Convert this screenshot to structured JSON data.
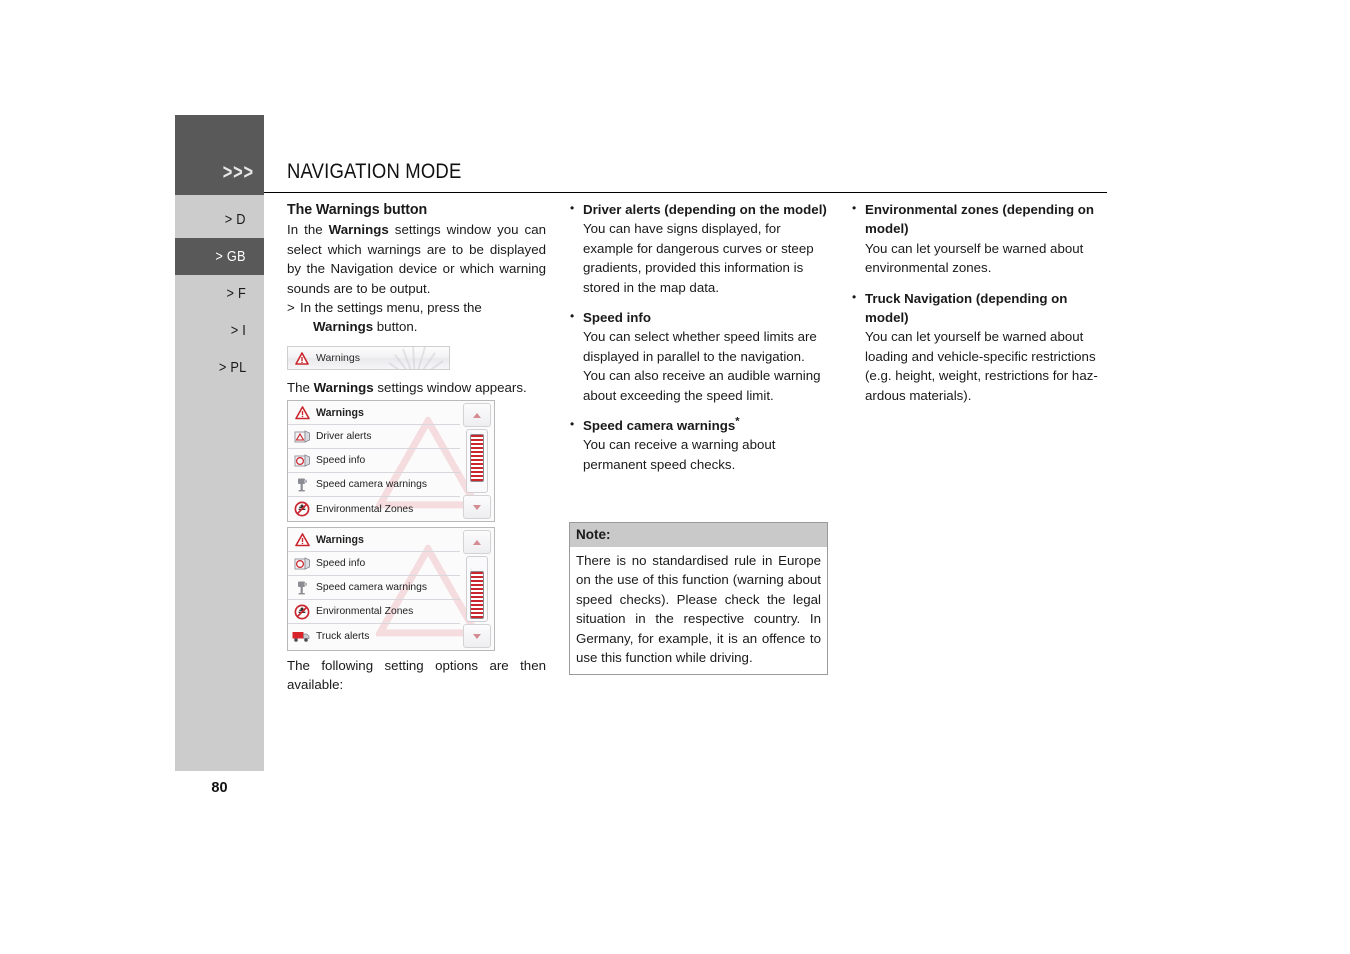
{
  "sidebar": {
    "chevrons": ">>>",
    "items": [
      {
        "label": "> D",
        "active": false
      },
      {
        "label": "> GB",
        "active": true
      },
      {
        "label": "> F",
        "active": false
      },
      {
        "label": "> I",
        "active": false
      },
      {
        "label": "> PL",
        "active": false
      }
    ]
  },
  "page_number": "80",
  "header": {
    "title": "NAVIGATION MODE"
  },
  "left_column": {
    "section_title": "The Warnings button",
    "intro_before": "In the ",
    "intro_bold": "Warnings",
    "intro_after": " settings window you can select which warnings are to be displayed by the Navigation device or which warning sounds are to be output.",
    "step_marker": ">",
    "step_text": "In the settings menu, press the ",
    "step_bold": "Warnings",
    "step_tail": " button.",
    "after_button_before": "The ",
    "after_button_bold": "Warnings",
    "after_button_after": " settings window appears.",
    "closing": "The following setting options are then available:"
  },
  "warnings_button": {
    "label": "Warnings",
    "icon": "warning-triangle-icon"
  },
  "screenshot_one": {
    "rows": [
      {
        "label": "Warnings",
        "icon": "warning-triangle-icon",
        "header": true
      },
      {
        "label": "Driver alerts",
        "icon": "road-sign-alert-icon",
        "header": false
      },
      {
        "label": "Speed info",
        "icon": "speed-sign-icon",
        "header": false
      },
      {
        "label": "Speed camera warnings",
        "icon": "speed-camera-icon",
        "header": false
      },
      {
        "label": "Environmental Zones",
        "icon": "environment-zone-icon",
        "header": false
      }
    ],
    "scroll_position": "top"
  },
  "screenshot_two": {
    "rows": [
      {
        "label": "Warnings",
        "icon": "warning-triangle-icon",
        "header": true
      },
      {
        "label": "Speed info",
        "icon": "speed-sign-icon",
        "header": false
      },
      {
        "label": "Speed camera warnings",
        "icon": "speed-camera-icon",
        "header": false
      },
      {
        "label": "Environmental Zones",
        "icon": "environment-zone-icon",
        "header": false
      },
      {
        "label": "Truck alerts",
        "icon": "truck-icon",
        "header": false
      }
    ],
    "scroll_position": "middle"
  },
  "middle_column": {
    "bullets": [
      {
        "title": "Driver alerts (depending on the model)",
        "text": "You can have signs displayed, for example for dangerous curves or steep gradients, provided this information is stored in the map data."
      },
      {
        "title": "Speed info",
        "text": "You can select whether speed limits are displayed in parallel to the navigation.\nYou can also receive an audible warning about exceeding the speed limit."
      },
      {
        "title": "Speed camera warnings",
        "title_suffix": "*",
        "text": "You can receive a warning about permanent speed checks."
      }
    ]
  },
  "note": {
    "heading": "Note:",
    "body": "There is no standardised rule in Europe on the use of this function (warning about speed checks). Please check the legal situation in the respective country. In Germany, for example, it is an offence to use this function while driving."
  },
  "right_column": {
    "bullets": [
      {
        "title": "Environmental zones (depending on model)",
        "text": "You can let yourself be warned about environmental zones."
      },
      {
        "title": "Truck Navigation (depending on model)",
        "text": "You can let yourself be warned about loading and vehicle-specific restrictions (e.g. height, weight, restrictions for haz-ardous materials)."
      }
    ]
  },
  "colors": {
    "sidebar_bg": "#cccccc",
    "sidebar_active": "#595959",
    "note_header": "#c9c9c9",
    "accent_red": "#c9262e"
  }
}
